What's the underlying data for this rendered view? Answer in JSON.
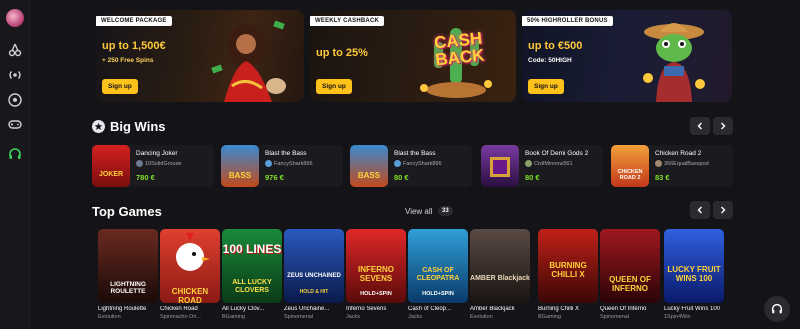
{
  "promos": [
    {
      "tag": "WELCOME PACKAGE",
      "headline": "up to 1,500€",
      "subline": "+ 250 Free Spins",
      "cta": "Sign up"
    },
    {
      "tag": "WEEKLY CASHBACK",
      "headline": "up to 25%",
      "subline": "",
      "cta": "Sign up",
      "art_text": "CASH BACK"
    },
    {
      "tag": "50% HIGHROLLER BONUS",
      "headline": "up to €500",
      "subline": "Code: 50HIGH",
      "cta": "Sign up"
    }
  ],
  "big_wins": {
    "title": "Big Wins",
    "items": [
      {
        "game": "Dancing Joker",
        "user": "10SolidGrouse",
        "amount": "780 €",
        "thumb_text": "JOKER",
        "thumb_color": "#d62020"
      },
      {
        "game": "Blast the Bass",
        "user": "FancyShark896",
        "amount": "976 €",
        "thumb_text": "BASS",
        "thumb_color": "#c24a1c"
      },
      {
        "game": "Blast the Bass",
        "user": "FancyShark896",
        "amount": "80 €",
        "thumb_text": "BASS",
        "thumb_color": "#c24a1c"
      },
      {
        "game": "Book Of Demi Gods 2",
        "user": "CivilMinnow561",
        "amount": "80 €",
        "thumb_text": "",
        "thumb_color": "#5a2a7a"
      },
      {
        "game": "Chicken Road 2",
        "user": "366EqualBasspod",
        "amount": "83 €",
        "thumb_text": "CHICKEN ROAD 2",
        "thumb_color": "#e8702a"
      }
    ]
  },
  "top_games": {
    "title": "Top Games",
    "view_all": "View all",
    "count": "33",
    "items": [
      {
        "title": "Lightning Roulette",
        "provider": "Evolution",
        "thumb_text": "LIGHTNING ROULETTE",
        "bg": "#3a1a14"
      },
      {
        "title": "Chicken Road",
        "provider": "Spinmacho Ori...",
        "thumb_text": "CHICKEN ROAD",
        "bg": "#b83228"
      },
      {
        "title": "All Lucky Clov...",
        "provider": "BGaming",
        "thumb_text": "100 LINES",
        "thumb_text2": "ALL LUCKY CLOVERS",
        "bg": "#0e6b2e"
      },
      {
        "title": "Zeus Unchaine...",
        "provider": "Spinomenal",
        "thumb_text": "ZEUS UNCHAINED",
        "thumb_text2": "HOLD & HIT",
        "bg": "#1c3a7a"
      },
      {
        "title": "Inferno Sevens",
        "provider": "Jacks",
        "thumb_text": "INFERNO SEVENS",
        "thumb_text2": "HOLD+SPIN",
        "bg": "#b0181c"
      },
      {
        "title": "Cash of Cleop...",
        "provider": "Jacks",
        "thumb_text": "CASH OF CLEOPATRA",
        "thumb_text2": "HOLD+SPIN",
        "bg": "#1a6aa8"
      },
      {
        "title": "Amber Blackjack",
        "provider": "Evolution",
        "thumb_text": "AMBER Blackjack",
        "bg": "#2a2422"
      },
      {
        "title": "Burning Chilli X",
        "provider": "BGaming",
        "thumb_text": "BURNING CHILLI X",
        "bg": "#8a1410"
      },
      {
        "title": "Queen Of Inferno",
        "provider": "Spinomenal",
        "thumb_text": "QUEEN OF INFERNO",
        "bg": "#5a0e12"
      },
      {
        "title": "Lucky Fruit Wins 100",
        "provider": "1Spin4Win",
        "thumb_text": "LUCKY FRUIT WINS 100",
        "bg": "#1a3aa8"
      }
    ]
  },
  "colors": {
    "accent": "#ffc21a",
    "win_amount": "#7ee022",
    "background": "#141317"
  }
}
